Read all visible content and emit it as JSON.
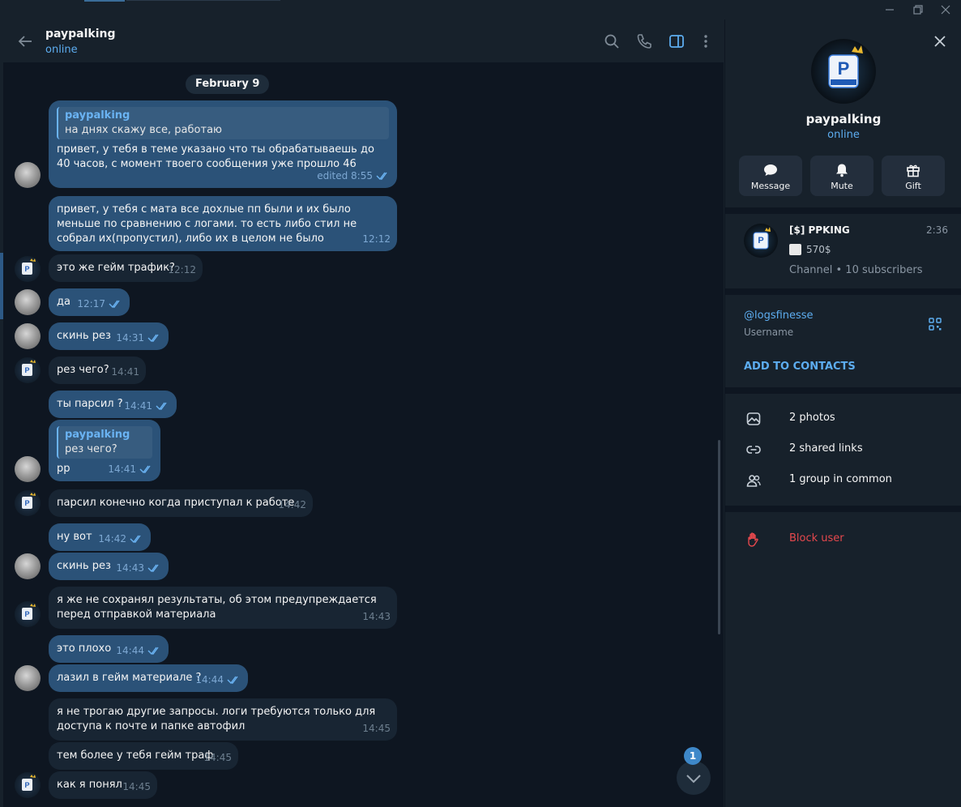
{
  "window": {
    "controls": {
      "minimize_icon": "minimize-icon",
      "restore_icon": "restore-icon",
      "close_icon": "close-icon"
    }
  },
  "header": {
    "name": "paypalking",
    "status": "online",
    "icons": [
      "back-arrow-icon",
      "search-icon",
      "phone-icon",
      "sidebar-toggle-icon",
      "more-vertical-icon"
    ]
  },
  "date_label": "February 9",
  "messages": [
    {
      "dir": "out",
      "reply_name": "paypalking",
      "reply_text": "на днях скажу все, работаю",
      "text": "привет, у тебя в теме указано что ты обрабатываешь до 40 часов, с момент твоего сообщения уже прошло 46",
      "time": "edited 8:55"
    },
    {
      "dir": "out",
      "text": "привет, у тебя с мата все дохлые пп были и их было меньше по сравнению с логами. то есть либо стил не собрал их(пропустил), либо их в целом не было",
      "time": "12:12"
    },
    {
      "dir": "in",
      "text": "это же гейм трафик?",
      "time": "12:12"
    },
    {
      "dir": "out",
      "text": "да",
      "time": "12:17"
    },
    {
      "dir": "out",
      "text": "скинь рез",
      "time": "14:31"
    },
    {
      "dir": "in",
      "text": "рез чего?",
      "time": "14:41"
    },
    {
      "dir": "out",
      "text": "ты парсил ?",
      "time": "14:41"
    },
    {
      "dir": "out",
      "reply_name": "paypalking",
      "reply_text": "рез чего?",
      "text": "рр",
      "time": "14:41"
    },
    {
      "dir": "in",
      "text": "парсил конечно когда приступал к работе",
      "time": "14:42"
    },
    {
      "dir": "out",
      "text": "ну вот",
      "time": "14:42"
    },
    {
      "dir": "out",
      "text": "скинь рез",
      "time": "14:43"
    },
    {
      "dir": "in",
      "text": "я же не сохранял результаты, об этом предупреждается перед отправкой материала",
      "time": "14:43"
    },
    {
      "dir": "out",
      "text": "это плохо",
      "time": "14:44"
    },
    {
      "dir": "out",
      "text": "лазил в гейм материале ?",
      "time": "14:44"
    },
    {
      "dir": "in",
      "text": "я не трогаю другие запросы. логи требуются только для доступа к почте и папке автофил",
      "time": "14:45"
    },
    {
      "dir": "in",
      "text": "тем более у тебя гейм траф",
      "time": "14:45"
    },
    {
      "dir": "in",
      "text": "как я понял",
      "time": "14:45"
    }
  ],
  "unread_badge": "1",
  "profile": {
    "name": "paypalking",
    "status": "online",
    "actions": [
      {
        "label": "Message",
        "icon": "message-icon"
      },
      {
        "label": "Mute",
        "icon": "bell-icon"
      },
      {
        "label": "Gift",
        "icon": "gift-icon"
      }
    ],
    "channel": {
      "title": "[$] PPKING",
      "time": "2:36",
      "snippet": "570$",
      "subtitle": "Channel • 10 subscribers"
    },
    "username": "@logsfinesse",
    "username_label": "Username",
    "add_contacts": "ADD TO CONTACTS",
    "media": [
      {
        "label": "2 photos",
        "icon": "photo-icon"
      },
      {
        "label": "2 shared links",
        "icon": "link-icon"
      },
      {
        "label": "1 group in common",
        "icon": "group-icon"
      }
    ],
    "block_label": "Block user"
  },
  "colors": {
    "background": "#0e1621",
    "panel": "#17212b",
    "outgoing_bubble": "#2b5278",
    "incoming_bubble": "#182533",
    "accent": "#5dadf0",
    "danger": "#e5484d"
  }
}
